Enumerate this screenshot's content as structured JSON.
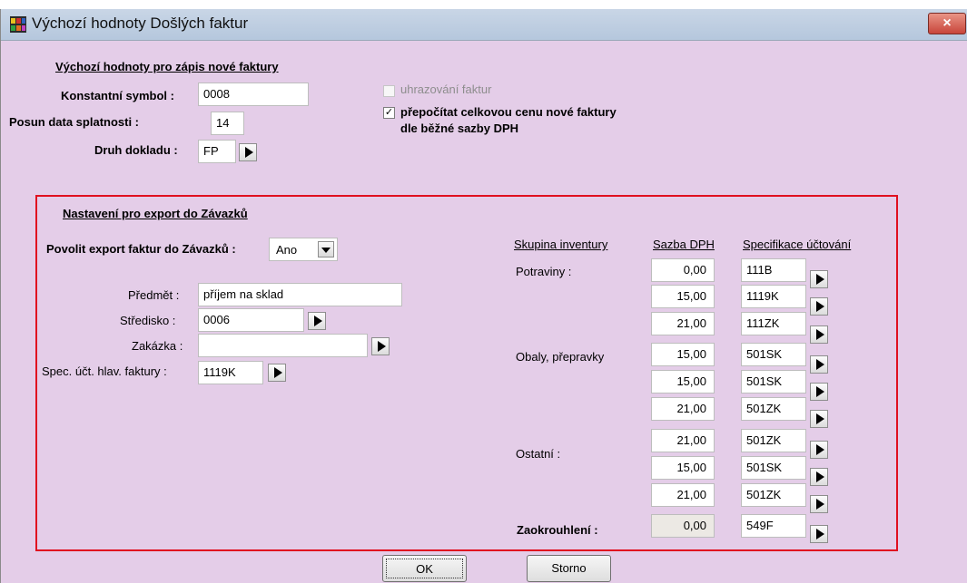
{
  "window": {
    "title": "Výchozí hodnoty Došlých faktur",
    "close_label": "×"
  },
  "defaults": {
    "header": "Výchozí hodnoty pro zápis nové faktury",
    "konstantni_symbol_label": "Konstantní symbol :",
    "konstantni_symbol_value": "0008",
    "posun_label": "Posun data splatnosti :",
    "posun_value": "14",
    "druh_label": "Druh dokladu :",
    "druh_value": "FP",
    "uhrazovani_label": "uhrazování faktur",
    "uhrazovani_checked": false,
    "prepocitat_label_1": "přepočítat celkovou cenu nové faktury",
    "prepocitat_label_2": "dle běžné sazby DPH",
    "prepocitat_checked": true,
    "check_mark": "✓"
  },
  "export": {
    "header": "Nastavení pro export do Závazků",
    "povolit_label": "Povolit export faktur do Závazků :",
    "povolit_value": "Ano",
    "predmet_label": "Předmět :",
    "predmet_value": "příjem na sklad",
    "stredisko_label": "Středisko :",
    "stredisko_value": "0006",
    "zakazka_label": "Zakázka :",
    "zakazka_value": "",
    "spec_label": "Spec. účt. hlav. faktury :",
    "spec_value": "1119K",
    "table_headers": {
      "skupina": "Skupina inventury",
      "sazba": "Sazba DPH",
      "specifikace": "Specifikace účtování"
    },
    "groups": [
      {
        "label": "Potraviny :"
      },
      {
        "label": "Obaly, přepravky"
      },
      {
        "label": "Ostatní :"
      },
      {
        "label": "Zaokrouhlení :"
      }
    ],
    "rows": [
      {
        "sazba": "0,00",
        "spec": "111B"
      },
      {
        "sazba": "15,00",
        "spec": "1119K"
      },
      {
        "sazba": "21,00",
        "spec": "111ZK"
      },
      {
        "sazba": "15,00",
        "spec": "501SK"
      },
      {
        "sazba": "15,00",
        "spec": "501SK"
      },
      {
        "sazba": "21,00",
        "spec": "501ZK"
      },
      {
        "sazba": "21,00",
        "spec": "501ZK"
      },
      {
        "sazba": "15,00",
        "spec": "501SK"
      },
      {
        "sazba": "21,00",
        "spec": "501ZK"
      },
      {
        "sazba": "0,00",
        "spec": "549F"
      }
    ]
  },
  "buttons": {
    "ok": "OK",
    "storno": "Storno"
  },
  "colors": {
    "background": "#e4cde8",
    "highlight_border": "#e01020",
    "close_button": "#c8453a"
  }
}
